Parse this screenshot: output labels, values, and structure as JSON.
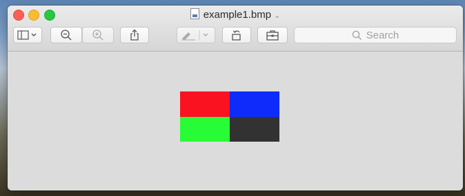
{
  "window": {
    "title": "example1.bmp",
    "title_chevron": "⌄"
  },
  "toolbar": {
    "sidebar_icon": "sidebar-icon",
    "zoom_out_icon": "zoom-out-icon",
    "zoom_in_icon": "zoom-in-icon",
    "share_icon": "share-icon",
    "markup_icon": "highlighter-icon",
    "rotate_icon": "rotate-icon",
    "toolbox_icon": "toolbox-icon"
  },
  "search": {
    "placeholder": "Search"
  },
  "image": {
    "pixels": [
      {
        "name": "red",
        "color": "#fb1221"
      },
      {
        "name": "blue",
        "color": "#0f2bfb"
      },
      {
        "name": "green",
        "color": "#28fc36"
      },
      {
        "name": "dark",
        "color": "#323232"
      }
    ]
  }
}
